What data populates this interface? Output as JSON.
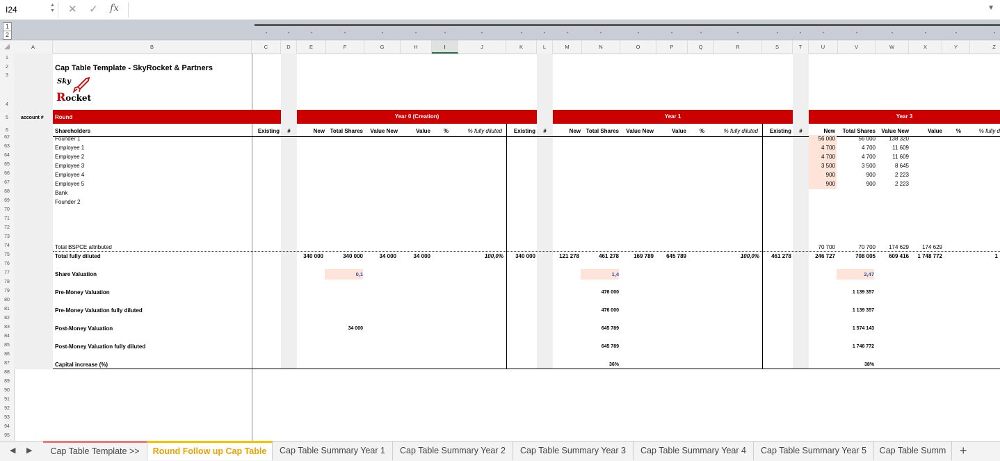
{
  "formula_bar": {
    "cell_ref": "I24",
    "cancel_icon": "✕",
    "confirm_icon": "✓",
    "fx_label": "fx",
    "formula": ""
  },
  "outline_levels": [
    "1",
    "2"
  ],
  "columns": [
    "A",
    "B",
    "C",
    "D",
    "E",
    "F",
    "G",
    "H",
    "I",
    "J",
    "K",
    "L",
    "M",
    "N",
    "O",
    "P",
    "Q",
    "R",
    "S",
    "T",
    "U",
    "V",
    "W",
    "X",
    "Y",
    "Z"
  ],
  "selected_column": "I",
  "rows": [
    "1",
    "2",
    "3",
    "4",
    "5",
    "6",
    "62",
    "63",
    "64",
    "65",
    "66",
    "67",
    "68",
    "69",
    "70",
    "71",
    "72",
    "73",
    "74",
    "75",
    "76",
    "77",
    "78",
    "79",
    "80",
    "81",
    "82",
    "83",
    "84",
    "85",
    "86",
    "87",
    "88",
    "89",
    "90",
    "91",
    "92",
    "93",
    "94",
    "95"
  ],
  "sheet": {
    "title": "Cap Table Template - SkyRocket & Partners",
    "logo_text_1": "Sky",
    "logo_text_2": "Rocket",
    "account_label": "account #",
    "round_label": "Round",
    "shareholders_label": "Shareholders",
    "year0_label": "Year 0 (Creation)",
    "year1_label": "Year 1",
    "year3_label": "Year 3",
    "hdr_existing": "Existing",
    "hdr_hash": "#",
    "hdr_new": "New",
    "hdr_total_shares": "Total Shares",
    "hdr_value_new": "Value New",
    "hdr_value": "Value",
    "hdr_pct": "%",
    "hdr_fully_diluted": "% fully diluted",
    "hdr_pct_cut": "% fully d",
    "shareholders": [
      "Founder 1",
      "Employee 1",
      "Employee 2",
      "Employee 3",
      "Employee 4",
      "Employee 5",
      "Bank",
      "Founder 2"
    ],
    "y3_new": [
      "56 000",
      "4 700",
      "4 700",
      "3 500",
      "900",
      "900"
    ],
    "y3_total": [
      "56 000",
      "4 700",
      "4 700",
      "3 500",
      "900",
      "900"
    ],
    "y3_value_new": [
      "138 320",
      "11 609",
      "11 609",
      "8 645",
      "2 223",
      "2 223"
    ],
    "total_bspce_label": "Total BSPCE attributed",
    "total_bspce": {
      "new": "70 700",
      "total": "70 700",
      "value_new": "174 629",
      "value": "174 629"
    },
    "total_fd_label": "Total fully diluted",
    "total_fd": {
      "y0_new": "340 000",
      "y0_total": "340 000",
      "y0_value_new": "34 000",
      "y0_value": "34 000",
      "y0_pct_fd": "100,0%",
      "y1_existing": "340 000",
      "y1_new": "121 278",
      "y1_total": "461 278",
      "y1_value_new": "169 789",
      "y1_value": "645 789",
      "y1_pct_fd": "100,0%",
      "y3_existing": "461 278",
      "y3_new": "246 727",
      "y3_total": "708 005",
      "y3_value_new": "609 416",
      "y3_value": "1 748 772",
      "y3_pct": "1"
    },
    "share_valuation_label": "Share Valuation",
    "share_valuation": {
      "y0": "0,1",
      "y1": "1,4",
      "y3": "2,47"
    },
    "pre_money_label": "Pre-Money Valuation",
    "pre_money": {
      "y1": "476 000",
      "y3": "1 139 357"
    },
    "pre_money_fd_label": "Pre-Money Valuation fully diluted",
    "pre_money_fd": {
      "y1": "476 000",
      "y3": "1 139 357"
    },
    "post_money_label": "Post-Money Valuation",
    "post_money": {
      "y0": "34 000",
      "y1": "645 789",
      "y3": "1 574 143"
    },
    "post_money_fd_label": "Post-Money Valuation fully diluted",
    "post_money_fd": {
      "y1": "645 789",
      "y3": "1 748 772"
    },
    "capital_increase_label": "Capital increase (%)",
    "capital_increase": {
      "y1": "36%",
      "y3": "38%"
    }
  },
  "tabs": {
    "prev_icon": "◀",
    "next_icon": "▶",
    "add_icon": "+",
    "items": [
      "Cap Table Template >>",
      "Round Follow up Cap Table",
      "Cap Table Summary Year 1",
      "Cap Table Summary Year 2",
      "Cap Table Summary Year 3",
      "Cap Table Summary Year 4",
      "Cap Table Summary Year 5",
      "Cap Table Summ"
    ],
    "active_index": 1
  }
}
